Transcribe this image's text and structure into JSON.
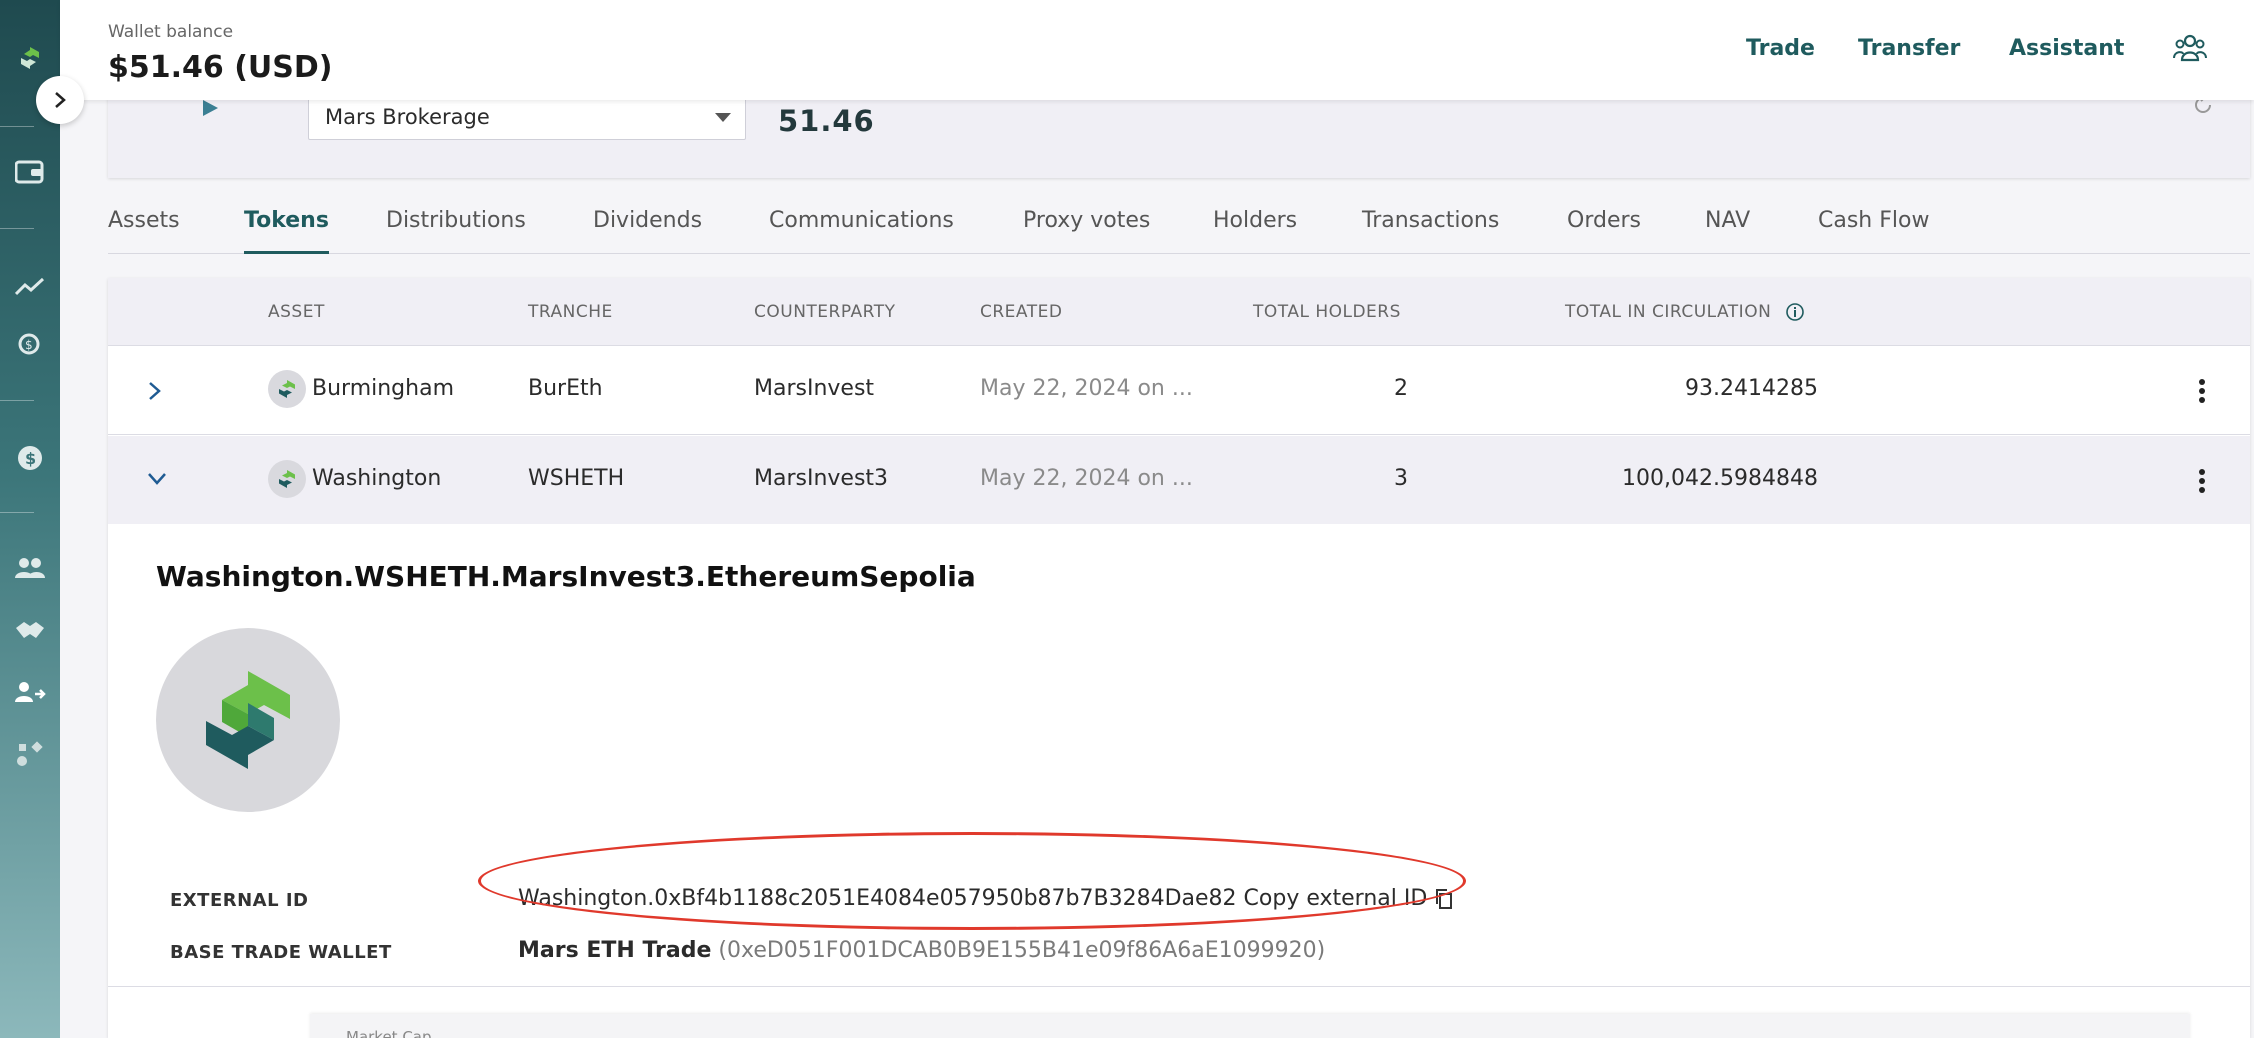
{
  "header": {
    "wallet_label": "Wallet balance",
    "wallet_value": "$51.46 (USD)",
    "nav": [
      "Trade",
      "Transfer",
      "Assistant"
    ]
  },
  "top_card": {
    "brokerage": "Mars Brokerage",
    "balance": "51.46"
  },
  "tabs": [
    {
      "label": "Assets",
      "active": false
    },
    {
      "label": "Tokens",
      "active": true
    },
    {
      "label": "Distributions",
      "active": false
    },
    {
      "label": "Dividends",
      "active": false
    },
    {
      "label": "Communications",
      "active": false
    },
    {
      "label": "Proxy votes",
      "active": false
    },
    {
      "label": "Holders",
      "active": false
    },
    {
      "label": "Transactions",
      "active": false
    },
    {
      "label": "Orders",
      "active": false
    },
    {
      "label": "NAV",
      "active": false
    },
    {
      "label": "Cash Flow",
      "active": false
    }
  ],
  "table": {
    "columns": [
      "ASSET",
      "TRANCHE",
      "COUNTERPARTY",
      "CREATED",
      "TOTAL HOLDERS",
      "TOTAL IN CIRCULATION"
    ],
    "rows": [
      {
        "asset": "Burmingham",
        "tranche": "BurEth",
        "counterparty": "MarsInvest",
        "created": "May 22, 2024 on ...",
        "holders": "2",
        "circulation": "93.2414285",
        "expanded": false
      },
      {
        "asset": "Washington",
        "tranche": "WSHETH",
        "counterparty": "MarsInvest3",
        "created": "May 22, 2024 on ...",
        "holders": "3",
        "circulation": "100,042.5984848",
        "expanded": true
      }
    ]
  },
  "detail": {
    "title": "Washington.WSHETH.MarsInvest3.EthereumSepolia",
    "external_id_label": "EXTERNAL ID",
    "external_id_value": "Washington.0xBf4b1188c2051E4084e057950b87b7B3284Dae82",
    "copy_label": "Copy external ID",
    "base_wallet_label": "BASE TRADE WALLET",
    "base_wallet_name": "Mars ETH Trade",
    "base_wallet_address": "(0xeD051F001DCAB0B9E155B41e09f86A6aE1099920)",
    "sub_card_label": "Market Cap"
  },
  "colors": {
    "accent": "#1f5b5e",
    "highlight_ring": "#e0392c",
    "logo_green": "#6cc04a",
    "logo_teal": "#1f5b5e"
  }
}
